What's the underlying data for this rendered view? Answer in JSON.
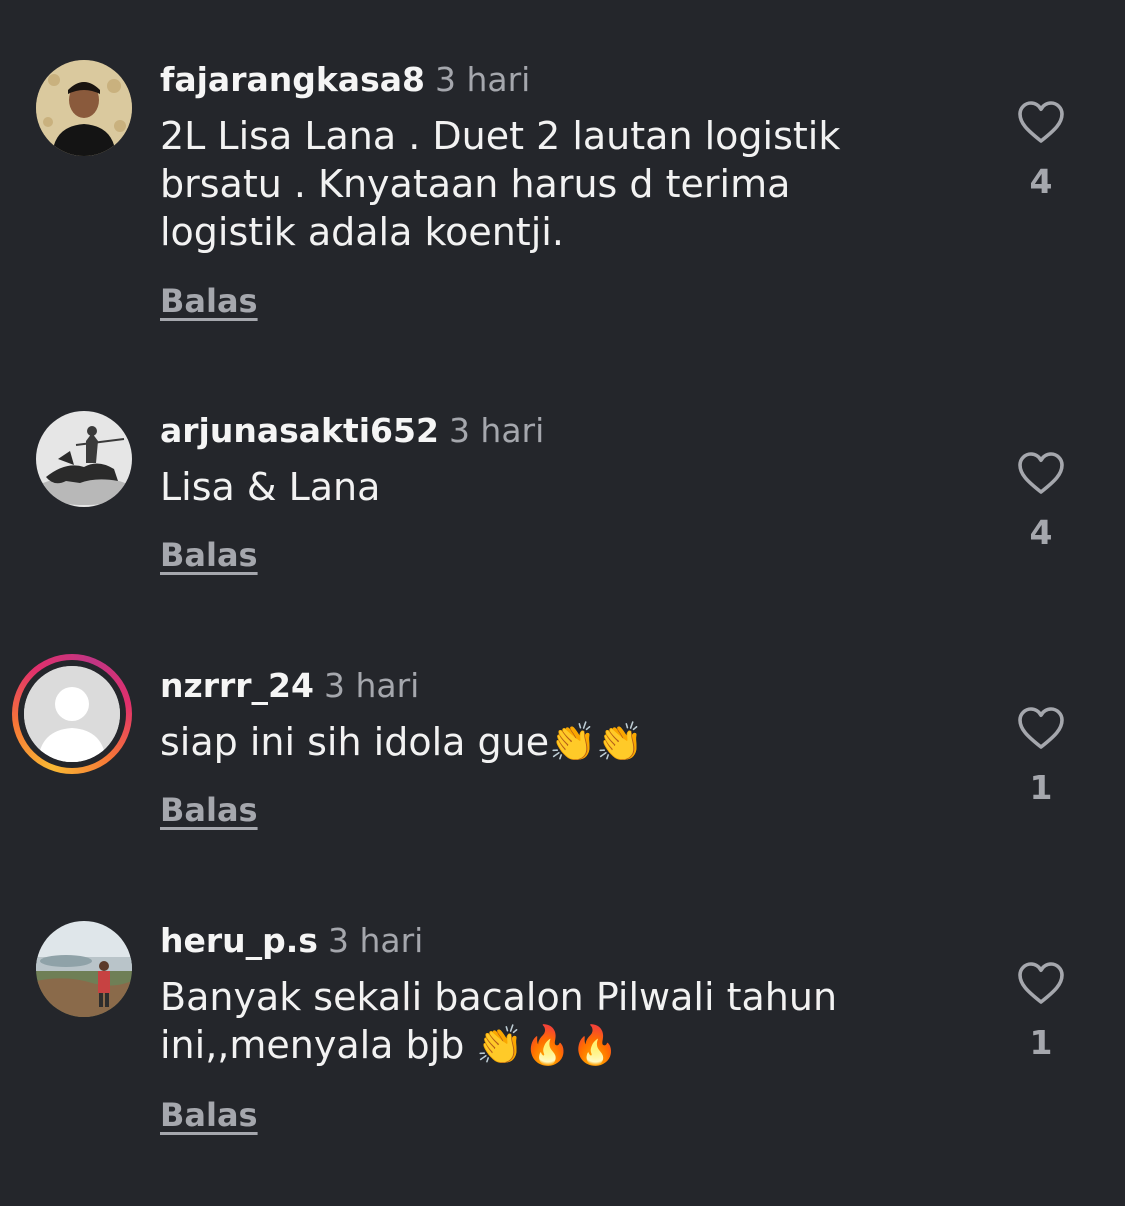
{
  "comments": [
    {
      "username": "fajarangkasa8",
      "time": "3 hari",
      "text": "2L Lisa Lana . Duet 2 lautan logistik\nbrsatu . Knyataan harus d terima\nlogistik adala koentji.",
      "likes": "4",
      "reply_label": "Balas"
    },
    {
      "username": "arjunasakti652",
      "time": "3 hari",
      "text": "Lisa & Lana",
      "likes": "4",
      "reply_label": "Balas"
    },
    {
      "username": "nzrrr_24",
      "time": "3 hari",
      "text": "siap ini sih idola gue👏👏",
      "likes": "1",
      "reply_label": "Balas"
    },
    {
      "username": "heru_p.s",
      "time": "3 hari",
      "text": "Banyak sekali bacalon Pilwali tahun\nini,,menyala bjb 👏🔥🔥",
      "likes": "1",
      "reply_label": "Balas"
    }
  ],
  "icons": {
    "like": "heart-outline-icon"
  },
  "colors": {
    "background": "#24262b",
    "primary_text": "#f2f2f2",
    "secondary_text": "#a5a7ad",
    "story_ring": [
      "#f9b934",
      "#e1306c",
      "#c13584"
    ]
  }
}
